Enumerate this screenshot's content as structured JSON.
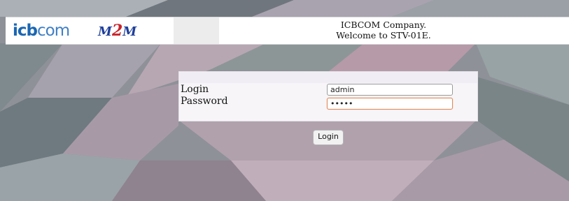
{
  "header": {
    "logo_left": {
      "part1": "icb",
      "part2": "com"
    },
    "logo_right": {
      "part1": "M",
      "part2": "2",
      "part3": "M"
    },
    "company_line1": "ICBCOM Company.",
    "company_line2": "Welcome to STV-01E."
  },
  "form": {
    "login_label": "Login",
    "password_label": "Password",
    "login_value": "admin",
    "password_value": "•••••",
    "submit_label": "Login"
  },
  "colors": {
    "brand_blue": "#1a66b3",
    "accent_red": "#c8242a"
  }
}
